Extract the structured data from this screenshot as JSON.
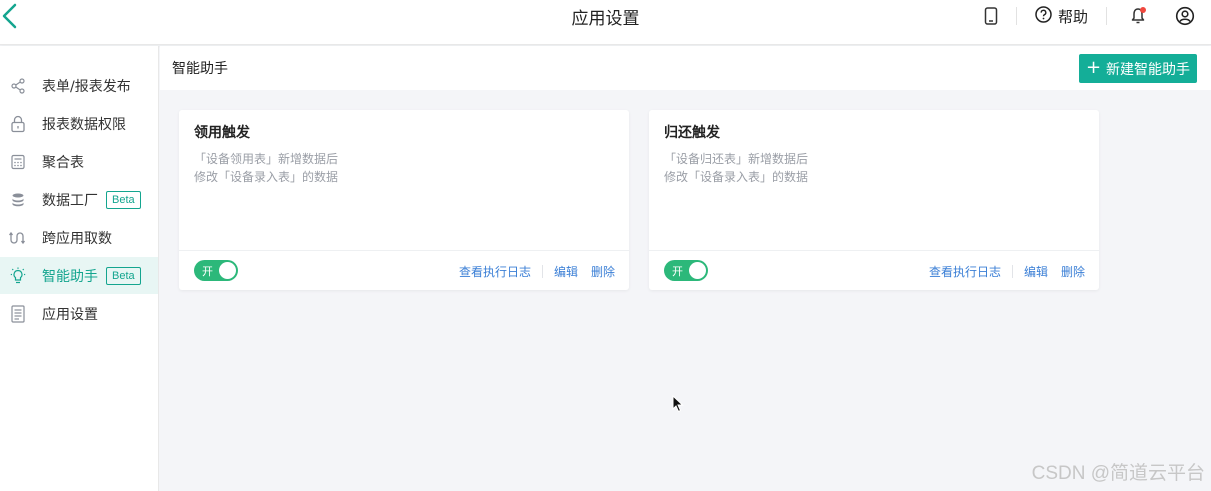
{
  "header": {
    "title": "应用设置",
    "help_label": "帮助",
    "icons": [
      "back-chevron-icon",
      "mobile-icon",
      "help-circle-icon",
      "bell-icon",
      "user-circle-icon"
    ],
    "notification_dot": true
  },
  "sidebar": {
    "items": [
      {
        "label": "表单/报表发布",
        "icon": "share-icon",
        "badge": ""
      },
      {
        "label": "报表数据权限",
        "icon": "lock-icon",
        "badge": ""
      },
      {
        "label": "聚合表",
        "icon": "calculator-icon",
        "badge": ""
      },
      {
        "label": "数据工厂",
        "icon": "database-icon",
        "badge": "Beta"
      },
      {
        "label": "跨应用取数",
        "icon": "cross-app-icon",
        "badge": ""
      },
      {
        "label": "智能助手",
        "icon": "lightbulb-icon",
        "badge": "Beta",
        "active": true
      },
      {
        "label": "应用设置",
        "icon": "document-icon",
        "badge": ""
      }
    ]
  },
  "content": {
    "title": "智能助手",
    "new_button_label": "新建智能助手",
    "cards": [
      {
        "title": "领用触发",
        "desc_line1": "「设备领用表」新增数据后",
        "desc_line2": "修改「设备录入表」的数据",
        "toggle_label": "开",
        "toggle_on": true,
        "links": {
          "log": "查看执行日志",
          "edit": "编辑",
          "delete": "删除"
        }
      },
      {
        "title": "归还触发",
        "desc_line1": "「设备归还表」新增数据后",
        "desc_line2": "修改「设备录入表」的数据",
        "toggle_label": "开",
        "toggle_on": true,
        "links": {
          "log": "查看执行日志",
          "edit": "编辑",
          "delete": "删除"
        }
      }
    ]
  },
  "watermark": "CSDN @简道云平台",
  "colors": {
    "accent": "#14ae98",
    "link": "#3b7fd6",
    "toggle_on": "#2cb87a",
    "badge_dot": "#f0483e"
  }
}
